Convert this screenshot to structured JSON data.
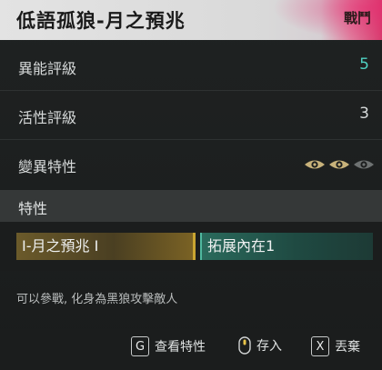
{
  "header": {
    "title": "低語孤狼-月之預兆",
    "badge": "戰鬥"
  },
  "stats": [
    {
      "label": "異能評級",
      "value": "5"
    },
    {
      "label": "活性評級",
      "value": "3"
    },
    {
      "label": "變異特性"
    }
  ],
  "mutation_eyes": {
    "filled": 2,
    "total": 3,
    "filled_color": "#c8b27a",
    "empty_color": "#6e7272"
  },
  "section": {
    "label": "特性"
  },
  "traits": [
    {
      "label": "I-月之預兆 I",
      "color": "#c9a531"
    },
    {
      "label": "拓展內在1",
      "color": "#4fb89f"
    }
  ],
  "description": "可以參戰, 化身為黑狼攻擊敵人",
  "footer": {
    "hints": [
      {
        "key": "G",
        "label": "查看特性"
      },
      {
        "key": "mouse-icon",
        "label": "存入"
      },
      {
        "key": "X",
        "label": "丟棄"
      }
    ]
  },
  "colors": {
    "accent": "#4fd1c2"
  }
}
